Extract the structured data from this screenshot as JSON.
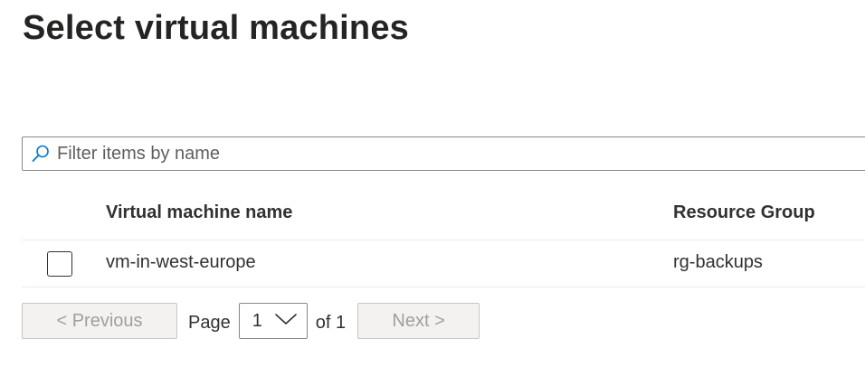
{
  "page": {
    "title": "Select virtual machines"
  },
  "filter": {
    "placeholder": "Filter items by name",
    "value": "",
    "icon": "search-icon"
  },
  "table": {
    "columns": [
      "Virtual machine name",
      "Resource Group"
    ],
    "rows": [
      {
        "selected": false,
        "name": "vm-in-west-europe",
        "resource_group": "rg-backups"
      }
    ]
  },
  "pagination": {
    "previous_label": "< Previous",
    "page_label": "Page",
    "current_page": "1",
    "of_label": "of 1",
    "next_label": "Next >",
    "dropdown_icon": "chevron-down-icon"
  },
  "colors": {
    "accent": "#0078d4",
    "text": "#323130",
    "disabled_text": "#a19f9d",
    "disabled_bg": "#f3f2f1"
  }
}
